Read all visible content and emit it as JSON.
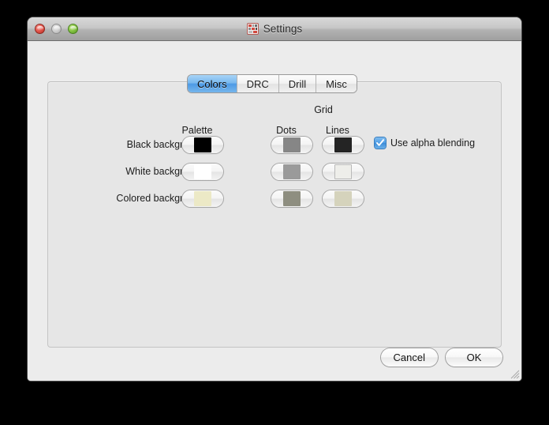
{
  "window": {
    "title": "Settings",
    "icon": "app-grid-icon",
    "controls": {
      "close": "close-button",
      "minimize": "minimize-button",
      "zoom": "zoom-button"
    }
  },
  "tabs": [
    {
      "label": "Colors",
      "selected": true
    },
    {
      "label": "DRC",
      "selected": false
    },
    {
      "label": "Drill",
      "selected": false
    },
    {
      "label": "Misc",
      "selected": false
    }
  ],
  "headers": {
    "group": "Grid",
    "palette": "Palette",
    "dots": "Dots",
    "lines": "Lines"
  },
  "rows": [
    {
      "label": "Black background",
      "palette": "#000000",
      "dots": "#868686",
      "lines": "#242424"
    },
    {
      "label": "White background",
      "palette": "#ffffff",
      "dots": "#9a9a9a",
      "lines": "#eeeeea"
    },
    {
      "label": "Colored background",
      "palette": "#ece9c6",
      "dots": "#8e8e80",
      "lines": "#d5d3bc"
    }
  ],
  "options": {
    "alpha_blending": {
      "label": "Use alpha blending",
      "checked": true
    }
  },
  "footer": {
    "cancel_label": "Cancel",
    "ok_label": "OK"
  },
  "colors": {
    "accent_tab": "#4d9ae5",
    "accent_checkbox": "#4e9ce4",
    "window_bg": "#ececec",
    "groupbox_bg": "#e6e6e6"
  }
}
